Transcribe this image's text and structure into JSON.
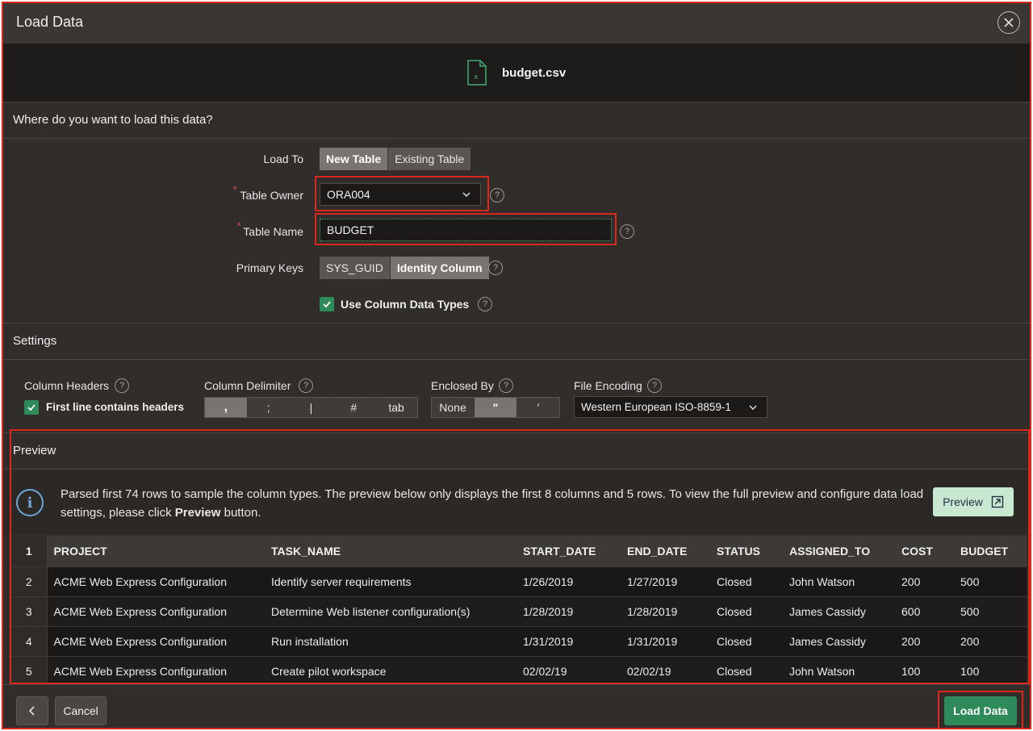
{
  "dialog": {
    "title": "Load Data",
    "close_icon": "close-icon"
  },
  "file": {
    "name": "budget.csv",
    "icon": "excel-file-icon"
  },
  "where": {
    "heading": "Where do you want to load this data?",
    "load_to": {
      "label": "Load To",
      "options": [
        "New Table",
        "Existing Table"
      ],
      "selected": "New Table"
    },
    "table_owner": {
      "label": "Table Owner",
      "value": "ORA004"
    },
    "table_name": {
      "label": "Table Name",
      "value": "BUDGET"
    },
    "primary_keys": {
      "label": "Primary Keys",
      "options": [
        "SYS_GUID",
        "Identity Column"
      ],
      "selected": "Identity Column"
    },
    "use_types": {
      "label": "Use Column Data Types",
      "checked": true
    }
  },
  "settings": {
    "heading": "Settings",
    "column_headers": {
      "label": "Column Headers",
      "checkbox_label": "First line contains headers",
      "checked": true
    },
    "column_delimiter": {
      "label": "Column Delimiter",
      "options": [
        ",",
        ";",
        "|",
        "#",
        "tab"
      ],
      "selected": ","
    },
    "enclosed_by": {
      "label": "Enclosed By",
      "options": [
        "None",
        "\"",
        "'"
      ],
      "selected": "\""
    },
    "file_encoding": {
      "label": "File Encoding",
      "value": "Western European ISO-8859-1"
    }
  },
  "preview": {
    "heading": "Preview",
    "info_text_pre": "Parsed first 74 rows to sample the column types. The preview below only displays the first 8 columns and 5 rows. To view the full preview and configure data load settings, please click ",
    "info_text_bold": "Preview",
    "info_text_post": " button.",
    "button_label": "Preview",
    "row_number_header": "1",
    "columns": [
      "PROJECT",
      "TASK_NAME",
      "START_DATE",
      "END_DATE",
      "STATUS",
      "ASSIGNED_TO",
      "COST",
      "BUDGET"
    ],
    "rows": [
      {
        "n": "2",
        "cells": [
          "ACME Web Express Configuration",
          "Identify server requirements",
          "1/26/2019",
          "1/27/2019",
          "Closed",
          "John Watson",
          "200",
          "500"
        ]
      },
      {
        "n": "3",
        "cells": [
          "ACME Web Express Configuration",
          "Determine Web listener configuration(s)",
          "1/28/2019",
          "1/28/2019",
          "Closed",
          "James Cassidy",
          "600",
          "500"
        ]
      },
      {
        "n": "4",
        "cells": [
          "ACME Web Express Configuration",
          "Run installation",
          "1/31/2019",
          "1/31/2019",
          "Closed",
          "James Cassidy",
          "200",
          "200"
        ]
      },
      {
        "n": "5",
        "cells": [
          "ACME Web Express Configuration",
          "Create pilot workspace",
          "02/02/19",
          "02/02/19",
          "Closed",
          "John Watson",
          "100",
          "100"
        ]
      }
    ]
  },
  "footer": {
    "cancel_label": "Cancel",
    "load_label": "Load Data"
  },
  "colors": {
    "accent": "#2f8a5a",
    "highlight": "#d9281c",
    "info": "#6fa6d8"
  }
}
